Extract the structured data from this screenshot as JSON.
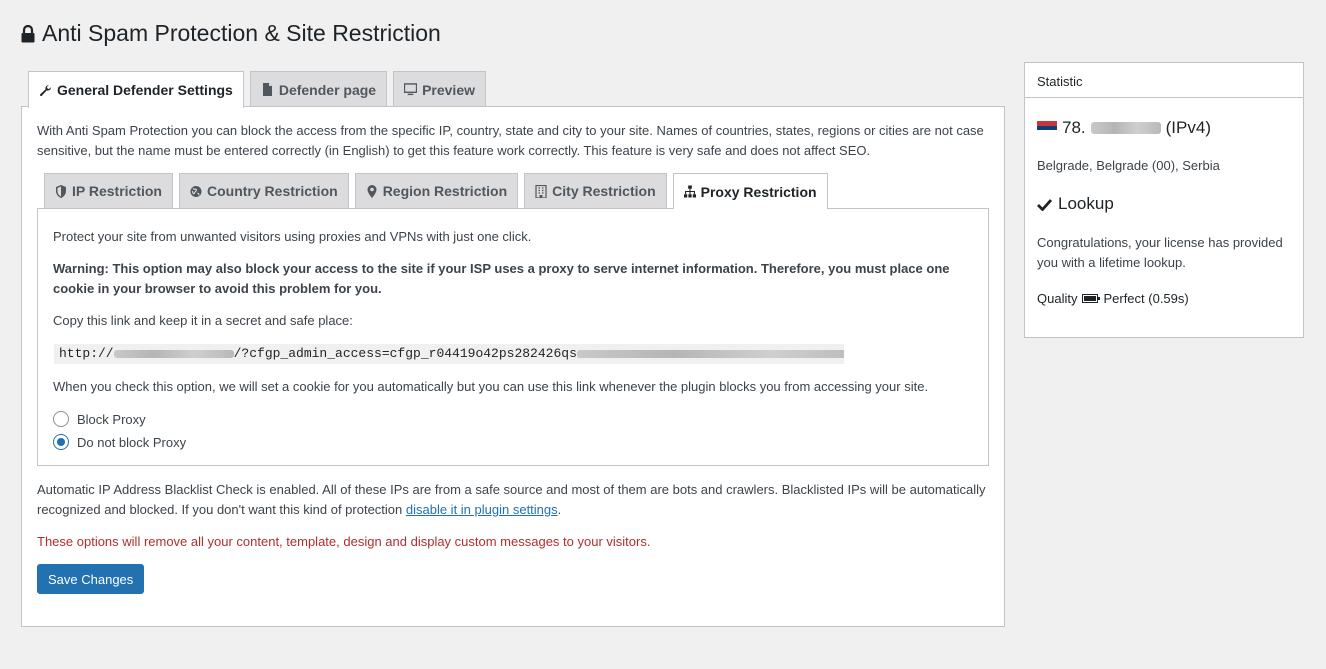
{
  "page": {
    "title": "Anti Spam Protection & Site Restriction"
  },
  "main_tabs": [
    {
      "label": "General Defender Settings",
      "icon": "wrench-icon",
      "active": true
    },
    {
      "label": "Defender page",
      "icon": "file-icon",
      "active": false
    },
    {
      "label": "Preview",
      "icon": "monitor-icon",
      "active": false
    }
  ],
  "intro": "With Anti Spam Protection you can block the access from the specific IP, country, state and city to your site. Names of countries, states, regions or cities are not case sensitive, but the name must be entered correctly (in English) to get this feature work correctly. This feature is very safe and does not affect SEO.",
  "sub_tabs": [
    {
      "label": "IP Restriction",
      "icon": "shield-icon",
      "active": false
    },
    {
      "label": "Country Restriction",
      "icon": "globe-icon",
      "active": false
    },
    {
      "label": "Region Restriction",
      "icon": "map-pin-icon",
      "active": false
    },
    {
      "label": "City Restriction",
      "icon": "building-icon",
      "active": false
    },
    {
      "label": "Proxy Restriction",
      "icon": "sitemap-icon",
      "active": true
    }
  ],
  "proxy": {
    "lead": "Protect your site from unwanted visitors using proxies and VPNs with just one click.",
    "warning": "Warning: This option may also block your access to the site if your ISP uses a proxy to serve internet information. Therefore, you must place one cookie in your browser to avoid this problem for you.",
    "copy_hint": "Copy this link and keep it in a secret and safe place:",
    "link_prefix": "http://",
    "link_visible": "/?cfgp_admin_access=cfgp_r04419o42ps282426qs",
    "auto_note": "When you check this option, we will set a cookie for you automatically but you can use this link whenever the plugin blocks you from accessing your site.",
    "options": [
      {
        "label": "Block Proxy",
        "checked": false
      },
      {
        "label": "Do not block Proxy",
        "checked": true
      }
    ]
  },
  "blacklist": {
    "text": "Automatic IP Address Blacklist Check is enabled. All of these IPs are from a safe source and most of them are bots and crawlers. Blacklisted IPs will be automatically recognized and blocked. If you don't want this kind of protection ",
    "link": "disable it in plugin settings",
    "suffix": "."
  },
  "danger_note": "These options will remove all your content, template, design and display custom messages to your visitors.",
  "save_label": "Save Changes",
  "statistic": {
    "title": "Statistic",
    "ip_prefix": "78.",
    "ip_version": "(IPv4)",
    "location": "Belgrade, Belgrade (00), Serbia",
    "lookup_title": "Lookup",
    "lookup_text": "Congratulations, your license has provided you with a lifetime lookup.",
    "quality_label": "Quality",
    "quality_value": "Perfect (0.59s)"
  },
  "colors": {
    "primary": "#2271b1",
    "danger": "#b32d2e",
    "background": "#f0f0f1"
  }
}
